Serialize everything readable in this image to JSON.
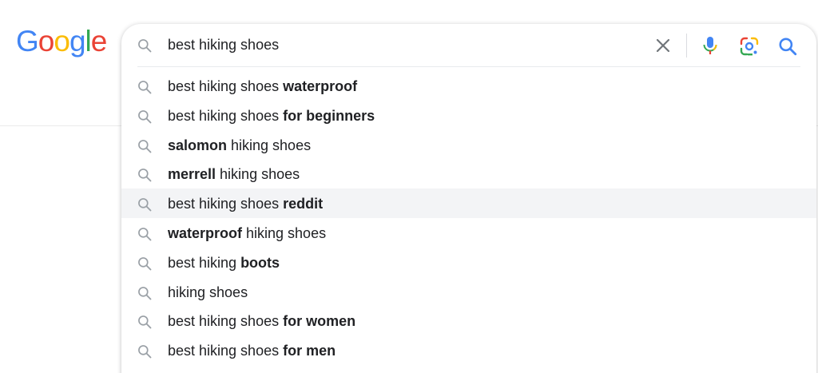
{
  "logo": {
    "letters": [
      {
        "char": "G",
        "color": "#4285F4"
      },
      {
        "char": "o",
        "color": "#EA4335"
      },
      {
        "char": "o",
        "color": "#FBBC05"
      },
      {
        "char": "g",
        "color": "#4285F4"
      },
      {
        "char": "l",
        "color": "#34A853"
      },
      {
        "char": "e",
        "color": "#EA4335"
      }
    ]
  },
  "search": {
    "query": "best hiking shoes",
    "icons": {
      "leading": "magnifier-icon",
      "clear": "close-icon",
      "voice": "microphone-icon",
      "image": "google-lens-icon",
      "submit": "search-icon"
    }
  },
  "suggestions": [
    {
      "parts": [
        {
          "text": "best hiking shoes ",
          "bold": false
        },
        {
          "text": "waterproof",
          "bold": true
        }
      ]
    },
    {
      "parts": [
        {
          "text": "best hiking shoes ",
          "bold": false
        },
        {
          "text": "for beginners",
          "bold": true
        }
      ]
    },
    {
      "parts": [
        {
          "text": "salomon",
          "bold": true
        },
        {
          "text": " hiking shoes",
          "bold": false
        }
      ]
    },
    {
      "parts": [
        {
          "text": "merrell",
          "bold": true
        },
        {
          "text": " hiking shoes",
          "bold": false
        }
      ]
    },
    {
      "parts": [
        {
          "text": "best hiking shoes ",
          "bold": false
        },
        {
          "text": "reddit",
          "bold": true
        }
      ],
      "highlighted": true
    },
    {
      "parts": [
        {
          "text": "waterproof",
          "bold": true
        },
        {
          "text": " hiking shoes",
          "bold": false
        }
      ]
    },
    {
      "parts": [
        {
          "text": "best hiking ",
          "bold": false
        },
        {
          "text": "boots",
          "bold": true
        }
      ]
    },
    {
      "parts": [
        {
          "text": "hiking shoes",
          "bold": false
        }
      ]
    },
    {
      "parts": [
        {
          "text": "best hiking shoes ",
          "bold": false
        },
        {
          "text": "for women",
          "bold": true
        }
      ]
    },
    {
      "parts": [
        {
          "text": "best hiking shoes ",
          "bold": false
        },
        {
          "text": "for men",
          "bold": true
        }
      ]
    }
  ],
  "colors": {
    "text": "#202124",
    "icon_gray": "#70757a",
    "search_blue": "#4285F4",
    "highlight_bg": "#f3f4f6"
  }
}
